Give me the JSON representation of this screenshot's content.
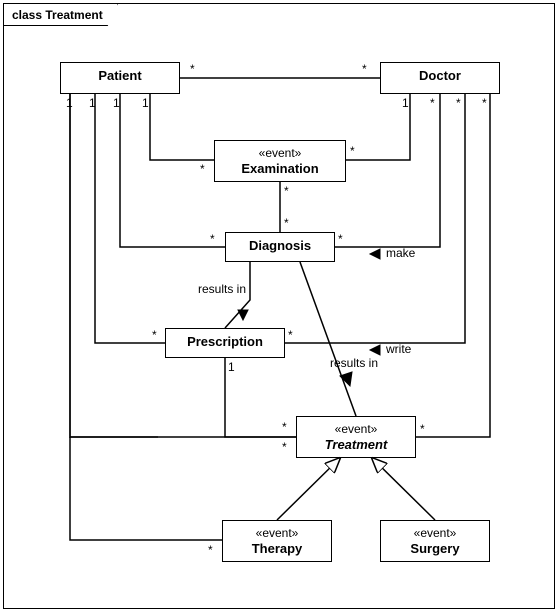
{
  "frame": {
    "title": "class Treatment"
  },
  "classes": {
    "patient": {
      "name": "Patient"
    },
    "doctor": {
      "name": "Doctor"
    },
    "examination": {
      "stereo": "«event»",
      "name": "Examination"
    },
    "diagnosis": {
      "name": "Diagnosis"
    },
    "prescription": {
      "name": "Prescription"
    },
    "treatment": {
      "stereo": "«event»",
      "name": "Treatment"
    },
    "therapy": {
      "stereo": "«event»",
      "name": "Therapy"
    },
    "surgery": {
      "stereo": "«event»",
      "name": "Surgery"
    }
  },
  "labels": {
    "resultsIn1": "results in",
    "resultsIn2": "results in",
    "make": "make",
    "write": "write"
  },
  "mult": {
    "one": "1",
    "star": "*"
  },
  "chart_data": {
    "type": "uml-class-diagram",
    "title": "class Treatment",
    "classes": [
      {
        "name": "Patient"
      },
      {
        "name": "Doctor"
      },
      {
        "name": "Examination",
        "stereotype": "event"
      },
      {
        "name": "Diagnosis"
      },
      {
        "name": "Prescription"
      },
      {
        "name": "Treatment",
        "stereotype": "event",
        "abstract": true
      },
      {
        "name": "Therapy",
        "stereotype": "event"
      },
      {
        "name": "Surgery",
        "stereotype": "event"
      }
    ],
    "associations": [
      {
        "ends": [
          {
            "class": "Patient",
            "mult": "*"
          },
          {
            "class": "Doctor",
            "mult": "*"
          }
        ]
      },
      {
        "ends": [
          {
            "class": "Patient",
            "mult": "1"
          },
          {
            "class": "Examination",
            "mult": "*"
          }
        ]
      },
      {
        "ends": [
          {
            "class": "Doctor",
            "mult": "1"
          },
          {
            "class": "Examination",
            "mult": "*"
          }
        ]
      },
      {
        "ends": [
          {
            "class": "Examination",
            "mult": "*"
          },
          {
            "class": "Diagnosis",
            "mult": "*"
          }
        ]
      },
      {
        "ends": [
          {
            "class": "Patient",
            "mult": "1"
          },
          {
            "class": "Diagnosis",
            "mult": "*"
          }
        ]
      },
      {
        "ends": [
          {
            "class": "Doctor",
            "mult": "*"
          },
          {
            "class": "Diagnosis",
            "mult": "*"
          }
        ],
        "name": "make"
      },
      {
        "ends": [
          {
            "class": "Diagnosis"
          },
          {
            "class": "Prescription"
          }
        ],
        "name": "results in"
      },
      {
        "ends": [
          {
            "class": "Diagnosis"
          },
          {
            "class": "Treatment"
          }
        ],
        "name": "results in"
      },
      {
        "ends": [
          {
            "class": "Patient",
            "mult": "1"
          },
          {
            "class": "Prescription",
            "mult": "*"
          }
        ]
      },
      {
        "ends": [
          {
            "class": "Doctor",
            "mult": "*"
          },
          {
            "class": "Prescription",
            "mult": "*"
          }
        ],
        "name": "write"
      },
      {
        "ends": [
          {
            "class": "Prescription",
            "mult": "1"
          },
          {
            "class": "Treatment",
            "mult": "*"
          }
        ]
      },
      {
        "ends": [
          {
            "class": "Patient",
            "mult": "1"
          },
          {
            "class": "Treatment",
            "mult": "*"
          }
        ]
      },
      {
        "ends": [
          {
            "class": "Doctor",
            "mult": "*"
          },
          {
            "class": "Treatment",
            "mult": "*"
          }
        ]
      },
      {
        "ends": [
          {
            "class": "Patient",
            "mult": "1"
          },
          {
            "class": "Therapy",
            "mult": "*"
          }
        ]
      }
    ],
    "generalizations": [
      {
        "child": "Therapy",
        "parent": "Treatment"
      },
      {
        "child": "Surgery",
        "parent": "Treatment"
      }
    ]
  }
}
